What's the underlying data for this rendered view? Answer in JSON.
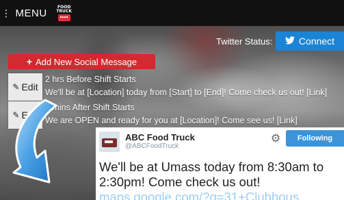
{
  "header": {
    "menu_label": "MENU",
    "logo_line1": "FOOD",
    "logo_line2": "TRUCK"
  },
  "twitter": {
    "status_label": "Twitter Status:",
    "connect_label": "Connect"
  },
  "add_button_label": "Add New Social Message",
  "messages": [
    {
      "edit_label": "Edit",
      "when": "2 hrs Before Shift Starts",
      "text": "We'll be at [Location] today from [Start] to [End]! Come check us out! [Link]"
    },
    {
      "edit_label": "Edit",
      "when": "0 mins After Shift Starts",
      "text": "We are OPEN and ready for you at [Location]! Come see us! [Link]"
    }
  ],
  "tweet": {
    "name": "ABC Food Truck",
    "handle": "@ABCFoodTruck",
    "follow_label": "Following",
    "body": "We'll be at Umass today from 8:30am to 2:30pm! Come check us out!",
    "link": "maps.google.com/?q=31+Clubhous..."
  },
  "colors": {
    "accent_red": "#d22a2f",
    "twitter_blue": "#1c84d4",
    "arrow_blue": "#3a8fd6"
  },
  "icons": {
    "menu": "menu-dots-icon",
    "logo": "food-truck-logo",
    "twitter": "twitter-bird-icon",
    "plus": "plus-icon",
    "edit": "pencil-icon",
    "gear": "gear-icon",
    "arrow": "curved-arrow-icon"
  }
}
